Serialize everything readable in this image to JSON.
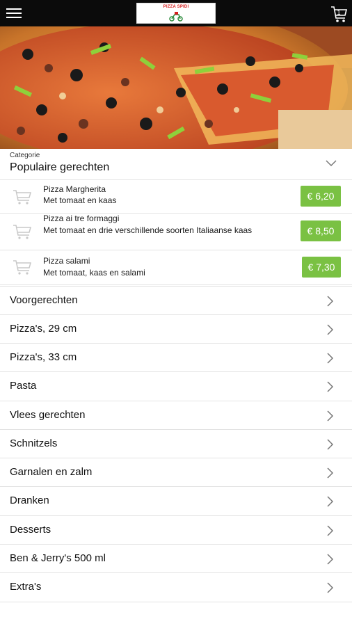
{
  "header": {
    "menu_icon": "hamburger-menu-icon",
    "logo_text": "PIZZA SPIDI",
    "cart_icon": "shopping-cart-icon",
    "cart_count": "1"
  },
  "category": {
    "label": "Categorie",
    "value": "Populaire gerechten"
  },
  "dishes": [
    {
      "name": "Pizza Margherita",
      "desc": "Met tomaat en kaas",
      "price": "€ 6,20"
    },
    {
      "name": "Pizza ai tre formaggi",
      "desc": "Met tomaat en drie verschillende soorten Italiaanse kaas",
      "price": "€ 8,50"
    },
    {
      "name": "Pizza salami",
      "desc": "Met tomaat, kaas en salami",
      "price": "€ 7,30"
    }
  ],
  "categories": [
    "Voorgerechten",
    "Pizza's, 29 cm",
    "Pizza's, 33 cm",
    "Pasta",
    "Vlees gerechten",
    "Schnitzels",
    "Garnalen en zalm",
    "Dranken",
    "Desserts",
    "Ben & Jerry's 500 ml",
    "Extra's"
  ],
  "colors": {
    "topbar": "#0b0b0b",
    "price_button": "#7ac143",
    "divider": "#e3e3e3"
  }
}
